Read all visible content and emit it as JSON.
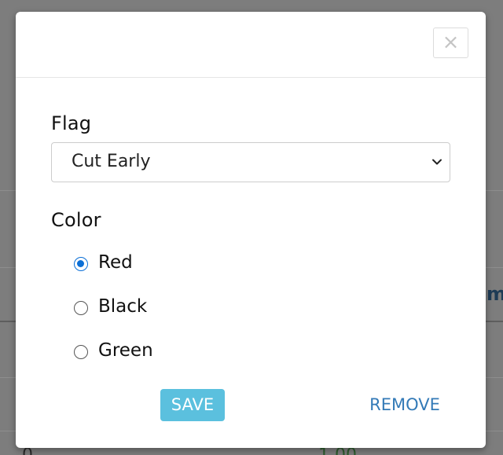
{
  "background": {
    "partial_heading": "m",
    "partial_left_digit": "0",
    "partial_right_value": "1.00"
  },
  "modal": {
    "close_icon": "×",
    "flag": {
      "label": "Flag",
      "selected": "Cut Early"
    },
    "color": {
      "label": "Color",
      "options": [
        {
          "label": "Red",
          "checked": true
        },
        {
          "label": "Black",
          "checked": false
        },
        {
          "label": "Green",
          "checked": false
        }
      ]
    },
    "actions": {
      "save_label": "SAVE",
      "remove_label": "REMOVE"
    }
  },
  "colors": {
    "save_button": "#5bc0de",
    "remove_link": "#337ab7",
    "radio_checked": "#0b6fd6",
    "overlay": "#7d7d7d"
  }
}
